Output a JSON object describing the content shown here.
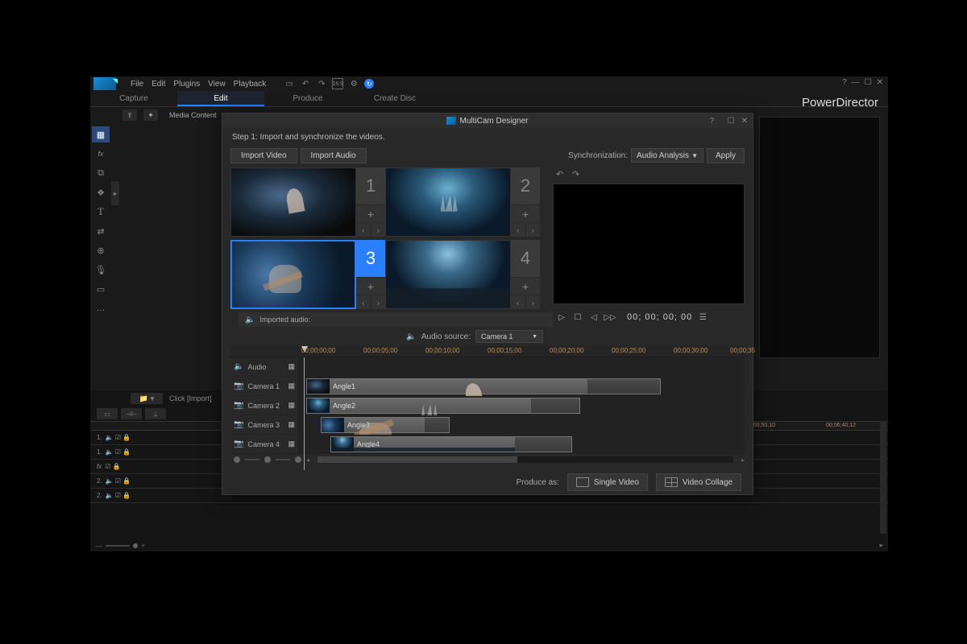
{
  "app": {
    "brand": "PowerDirector",
    "menu": [
      "File",
      "Edit",
      "Plugins",
      "View",
      "Playback"
    ],
    "main_tabs": [
      "Capture",
      "Edit",
      "Produce",
      "Create Disc"
    ],
    "active_tab": "Edit",
    "media_content_label": "Media Content",
    "import_hint": "Click [Import]"
  },
  "modal": {
    "title": "MultiCam Designer",
    "step_text": "Step 1: Import and synchronize the videos.",
    "import_video": "Import Video",
    "import_audio": "Import Audio",
    "sync_label": "Synchronization:",
    "sync_value": "Audio Analysis",
    "apply": "Apply",
    "cameras": [
      {
        "num": "1",
        "selected": false
      },
      {
        "num": "2",
        "selected": false
      },
      {
        "num": "3",
        "selected": true
      },
      {
        "num": "4",
        "selected": false
      }
    ],
    "imported_audio_label": "Imported audio:",
    "audio_source_label": "Audio source:",
    "audio_source_value": "Camera 1",
    "timecode": "00; 00; 00; 00",
    "ruler_ticks": [
      "00;00;00;00",
      "00;00;05;00",
      "00;00;10;00",
      "00;00;15;00",
      "00;00;20;00",
      "00;00;25;00",
      "00;00;30;00",
      "00;00;35"
    ],
    "tracks": {
      "audio": "Audio",
      "cams": [
        "Camera 1",
        "Camera 2",
        "Camera 3",
        "Camera 4"
      ],
      "clips": [
        "Angle1",
        "Angle2",
        "Angle3",
        "Angle4"
      ]
    },
    "produce_label": "Produce as:",
    "produce_single": "Single Video",
    "produce_collage": "Video Collage"
  },
  "bg_timeline": {
    "ruler_ticks": [
      "00;50;10",
      "00;06;40;12"
    ],
    "track_labels": [
      "1.",
      "1.",
      "fx",
      "2.",
      "2."
    ]
  }
}
